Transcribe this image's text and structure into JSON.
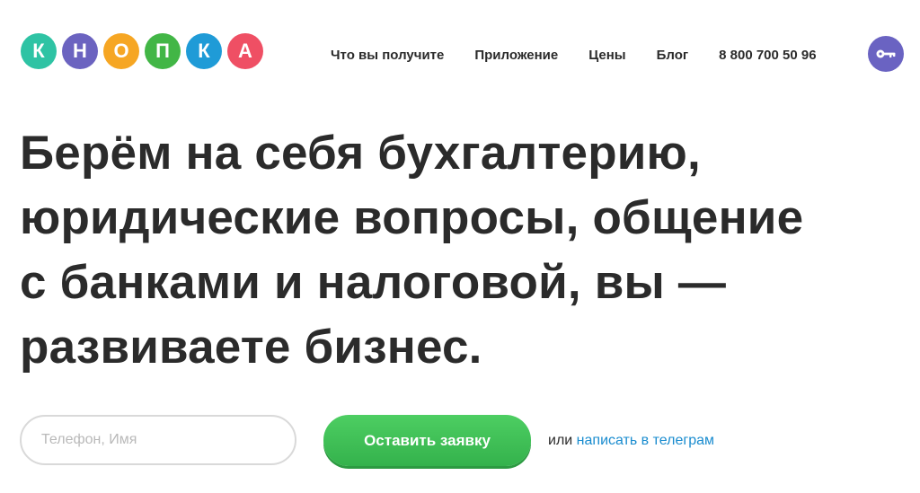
{
  "logo": {
    "letters": [
      {
        "char": "К",
        "color": "#2ec3a4"
      },
      {
        "char": "Н",
        "color": "#6b63c0"
      },
      {
        "char": "О",
        "color": "#f6a623"
      },
      {
        "char": "П",
        "color": "#42b646"
      },
      {
        "char": "К",
        "color": "#1f9bd7"
      },
      {
        "char": "А",
        "color": "#ef4f64"
      }
    ]
  },
  "nav": {
    "items": [
      "Что вы получите",
      "Приложение",
      "Цены",
      "Блог"
    ],
    "phone": "8 800 700 50 96",
    "login_icon": "key-icon"
  },
  "hero": {
    "lines": [
      "Берём на себя бухгалтерию,",
      "юридические вопросы, общение",
      "с банками и налоговой, вы —",
      "развиваете бизнес."
    ]
  },
  "form": {
    "input_placeholder": "Телефон, Имя",
    "input_value": "",
    "submit_label": "Оставить заявку",
    "alt_prefix": "или",
    "alt_link": "написать в телеграм"
  },
  "colors": {
    "accent_green": "#3bbd52",
    "link_blue": "#1a8ccf",
    "login_purple": "#6a63c2",
    "text_dark": "#2b2b2b"
  }
}
